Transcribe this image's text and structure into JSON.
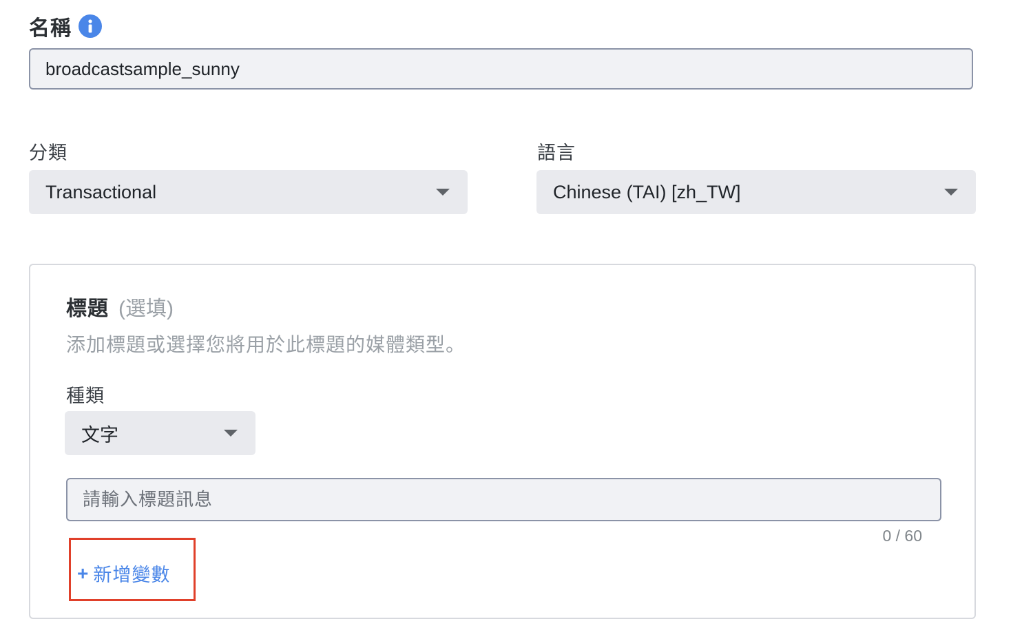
{
  "name": {
    "label": "名稱",
    "info_icon": "info-icon",
    "value": "broadcastsample_sunny"
  },
  "category": {
    "label": "分類",
    "selected": "Transactional",
    "icon": "caret-down-icon"
  },
  "language": {
    "label": "語言",
    "selected": "Chinese (TAI) [zh_TW]",
    "icon": "caret-down-icon"
  },
  "header_card": {
    "title": "標題",
    "optional": "(選填)",
    "description": "添加標題或選擇您將用於此標題的媒體類型。",
    "type_label": "種類",
    "type_selected": "文字",
    "input_placeholder": "請輸入標題訊息",
    "input_value": "",
    "char_counter": "0 / 60",
    "add_variable_label": "新增變數",
    "add_variable_prefix": "+"
  },
  "colors": {
    "accent": "#4a86e8",
    "highlight_border": "#e0402a",
    "field_bg": "#f1f2f5",
    "select_bg": "#e9eaee"
  }
}
